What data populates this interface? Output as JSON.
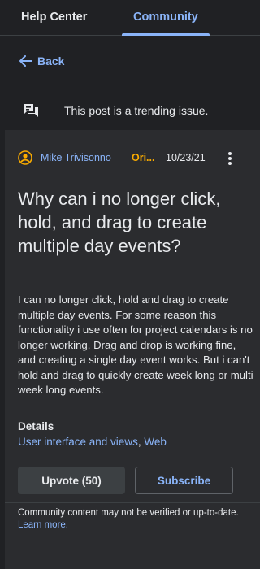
{
  "nav": {
    "help_center": "Help Center",
    "community": "Community"
  },
  "back_label": "Back",
  "banner": {
    "text": "This post is a trending issue.",
    "icon": "chat-bubbles-icon"
  },
  "post": {
    "author": "Mike Trivisonno",
    "badge": "Ori...",
    "date": "10/23/21",
    "title": "Why can i no longer click, hold, and drag to create multiple day events?",
    "body": "I can no longer click, hold and drag to create multiple day events. For some reason this functionality i use often for project calendars is no longer working. Drag and drop is working fine, and creating a single day event works. But i can't hold and drag to quickly create week long or multi week long events.",
    "details_label": "Details",
    "details": [
      "User interface and views",
      "Web"
    ],
    "upvote_label": "Upvote (50)",
    "subscribe_label": "Subscribe"
  },
  "footer": {
    "text": "Community content may not be verified or up-to-date.",
    "link": "Learn more."
  },
  "colors": {
    "accent": "#8ab4f8",
    "badge": "#f9ab00",
    "background": "#202124",
    "card": "#2b2c2f"
  }
}
